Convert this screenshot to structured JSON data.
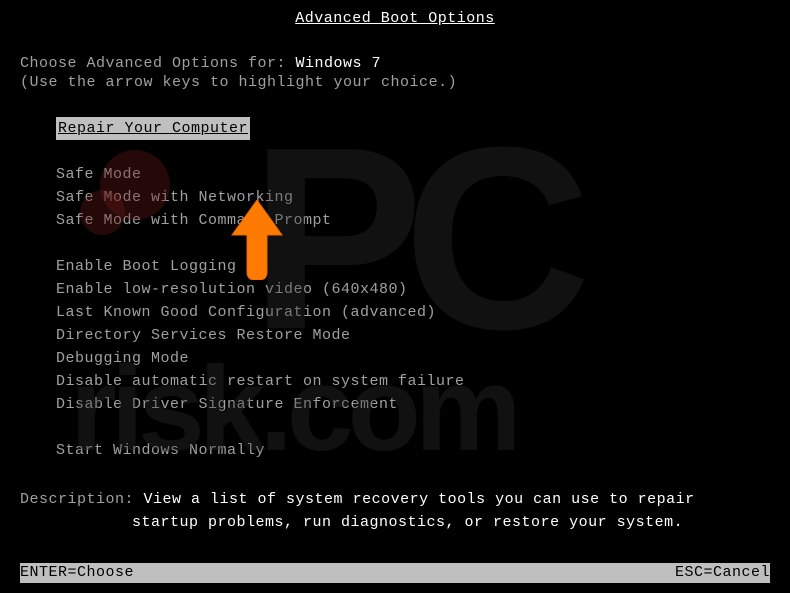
{
  "title": "Advanced Boot Options",
  "prompt_prefix": "Choose Advanced Options for: ",
  "os_name": "Windows 7",
  "hint": "(Use the arrow keys to highlight your choice.)",
  "selected_item": "Repair Your Computer",
  "menu_group1": [
    "Safe Mode",
    "Safe Mode with Networking",
    "Safe Mode with Command Prompt"
  ],
  "menu_group2": [
    "Enable Boot Logging",
    "Enable low-resolution video (640x480)",
    "Last Known Good Configuration (advanced)",
    "Directory Services Restore Mode",
    "Debugging Mode",
    "Disable automatic restart on system failure",
    "Disable Driver Signature Enforcement"
  ],
  "menu_group3": [
    "Start Windows Normally"
  ],
  "description_label": "Description: ",
  "description_line1": "View a list of system recovery tools you can use to repair",
  "description_line2": "startup problems, run diagnostics, or restore your system.",
  "footer_left": "ENTER=Choose",
  "footer_right": "ESC=Cancel",
  "watermark_top": "PC",
  "watermark_bottom": "risk.com"
}
